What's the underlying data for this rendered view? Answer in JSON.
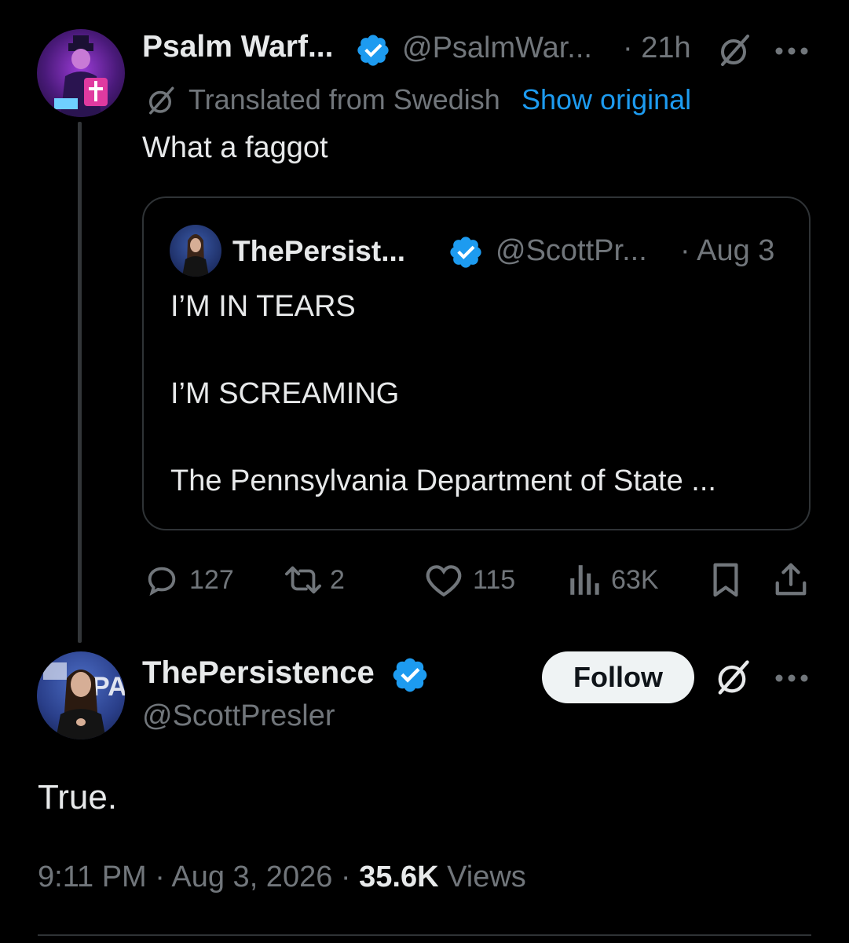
{
  "top_tweet": {
    "author_name": "Psalm Warf...",
    "handle": "@PsalmWar...",
    "time": "· 21h",
    "translation_note": "Translated from Swedish",
    "show_original": "Show original",
    "text": "What a faggot",
    "quoted": {
      "author_name": "ThePersist...",
      "handle": "@ScottPr...",
      "date": "· Aug 3",
      "line1": "I’M IN TEARS",
      "line2": "I’M SCREAMING",
      "line3": "The Pennsylvania Department of State ..."
    },
    "stats": {
      "replies": "127",
      "reposts": "2",
      "likes": "115",
      "views": "63K"
    }
  },
  "main_tweet": {
    "author_name": "ThePersistence",
    "handle": "@ScottPresler",
    "follow_label": "Follow",
    "text": "True.",
    "time": "9:11 PM",
    "sep1": "·",
    "date": "Aug 3, 2026",
    "sep2": "·",
    "views_count": "35.6K",
    "views_label": "Views"
  },
  "colors": {
    "background": "#000000",
    "text": "#e7e9ea",
    "muted": "#71767b",
    "link": "#1d9bf0",
    "verified": "#1d9bf0",
    "border": "#2f3336"
  }
}
